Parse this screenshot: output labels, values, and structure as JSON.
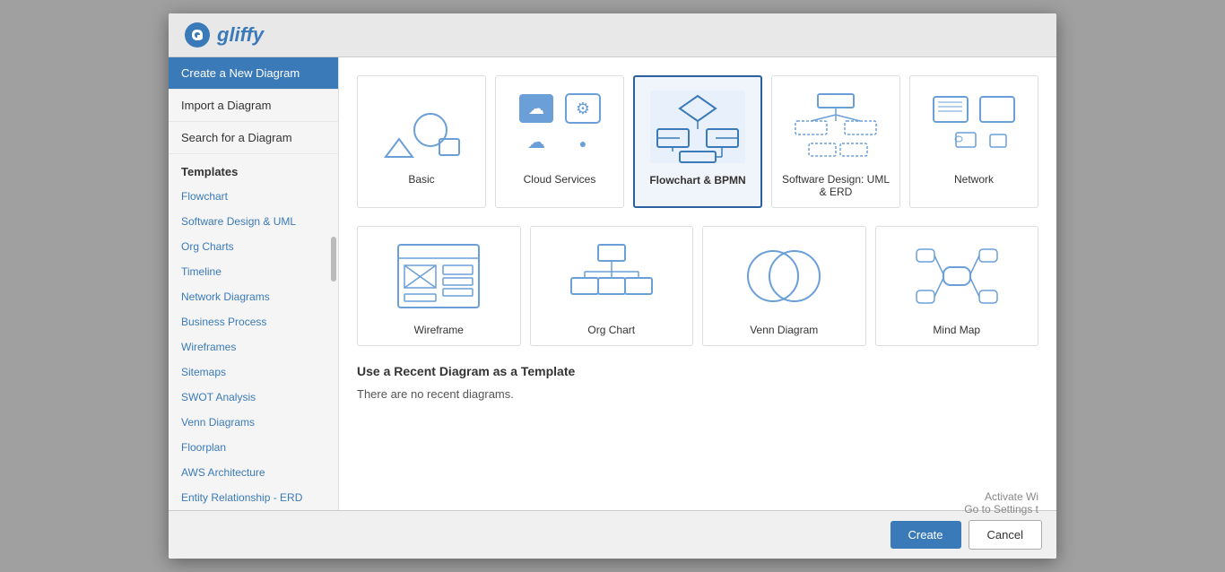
{
  "header": {
    "logo_text": "gliffy",
    "logo_icon": "gliffy-logo"
  },
  "sidebar": {
    "nav_items": [
      {
        "label": "Create a New Diagram",
        "active": true
      },
      {
        "label": "Import a Diagram",
        "active": false
      },
      {
        "label": "Search for a Diagram",
        "active": false
      }
    ],
    "section_title": "Templates",
    "template_items": [
      {
        "label": "Flowchart"
      },
      {
        "label": "Software Design & UML"
      },
      {
        "label": "Org Charts"
      },
      {
        "label": "Timeline"
      },
      {
        "label": "Network Diagrams"
      },
      {
        "label": "Business Process"
      },
      {
        "label": "Wireframes"
      },
      {
        "label": "Sitemaps"
      },
      {
        "label": "SWOT Analysis"
      },
      {
        "label": "Venn Diagrams"
      },
      {
        "label": "Floorplan"
      },
      {
        "label": "AWS Architecture"
      },
      {
        "label": "Entity Relationship - ERD"
      }
    ]
  },
  "content": {
    "template_cards_row1": [
      {
        "label": "Basic",
        "selected": false
      },
      {
        "label": "Cloud Services",
        "selected": false
      },
      {
        "label": "Flowchart & BPMN",
        "selected": true
      },
      {
        "label": "Software Design: UML & ERD",
        "selected": false
      },
      {
        "label": "Network",
        "selected": false
      }
    ],
    "template_cards_row2": [
      {
        "label": "Wireframe",
        "selected": false
      },
      {
        "label": "Org Chart",
        "selected": false
      },
      {
        "label": "Venn Diagram",
        "selected": false
      },
      {
        "label": "Mind Map",
        "selected": false
      }
    ],
    "recent_section_title": "Use a Recent Diagram as a Template",
    "recent_empty_text": "There are no recent diagrams."
  },
  "footer": {
    "create_label": "Create",
    "cancel_label": "Cancel"
  },
  "watermark": {
    "line1": "Activate Wi",
    "line2": "Go to Settings t"
  }
}
